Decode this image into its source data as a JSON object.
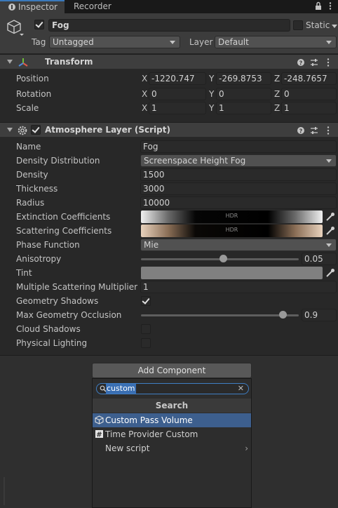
{
  "tabs": [
    {
      "label": "Inspector",
      "icon": "info-icon"
    },
    {
      "label": "Recorder"
    }
  ],
  "object": {
    "name": "Fog",
    "active": true,
    "static_label": "Static",
    "static": false,
    "tag_label": "Tag",
    "tag_value": "Untagged",
    "layer_label": "Layer",
    "layer_value": "Default"
  },
  "transform": {
    "title": "Transform",
    "position_label": "Position",
    "rotation_label": "Rotation",
    "scale_label": "Scale",
    "axis_x": "X",
    "axis_y": "Y",
    "axis_z": "Z",
    "position": {
      "x": "-1220.747",
      "y": "-269.8753",
      "z": "-248.7657"
    },
    "rotation": {
      "x": "0",
      "y": "0",
      "z": "0"
    },
    "scale": {
      "x": "1",
      "y": "1",
      "z": "1"
    }
  },
  "atmosphere": {
    "title": "Atmosphere Layer (Script)",
    "enabled": true,
    "name_label": "Name",
    "name_value": "Fog",
    "density_distribution_label": "Density Distribution",
    "density_distribution_value": "Screenspace Height Fog",
    "density_label": "Density",
    "density_value": "1500",
    "thickness_label": "Thickness",
    "thickness_value": "3000",
    "radius_label": "Radius",
    "radius_value": "10000",
    "extinction_label": "Extinction Coefficients",
    "extinction_hdr": "HDR",
    "scattering_label": "Scattering Coefficients",
    "scattering_hdr": "HDR",
    "phase_label": "Phase Function",
    "phase_value": "Mie",
    "anisotropy_label": "Anisotropy",
    "anisotropy_value": "0.05",
    "anisotropy_fraction": 0.52,
    "tint_label": "Tint",
    "tint_color": "#808080",
    "msm_label": "Multiple Scattering Multiplier",
    "msm_value": "1",
    "geometry_shadows_label": "Geometry Shadows",
    "geometry_shadows": true,
    "max_occlusion_label": "Max Geometry Occlusion",
    "max_occlusion_value": "0.9",
    "max_occlusion_fraction": 0.9,
    "cloud_shadows_label": "Cloud Shadows",
    "cloud_shadows": false,
    "physical_lighting_label": "Physical Lighting",
    "physical_lighting": false
  },
  "add_component": {
    "button_label": "Add Component",
    "search_value": "custom",
    "section_title": "Search",
    "items": [
      {
        "label": "Custom Pass Volume",
        "icon": "cube-icon",
        "selected": true
      },
      {
        "label": "Time Provider Custom",
        "icon": "script-icon",
        "selected": false
      },
      {
        "label": "New script",
        "icon": "",
        "selected": false,
        "submenu": true
      }
    ]
  },
  "colors": {
    "accent": "#3a79bb",
    "selection": "#3d5f8e",
    "panel": "#3c3c3c",
    "background": "#282828"
  }
}
